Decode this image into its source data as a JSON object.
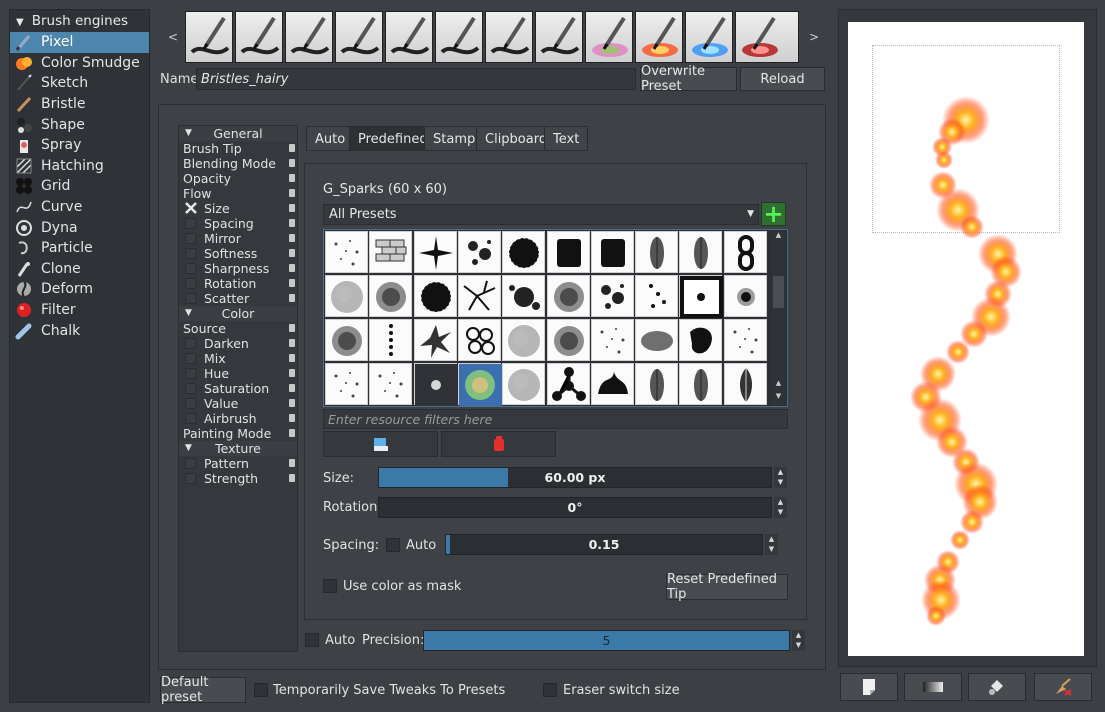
{
  "engines": {
    "header": "Brush engines",
    "items": [
      {
        "label": "Pixel",
        "icon": "pixel-brush-icon",
        "selected": true
      },
      {
        "label": "Color Smudge",
        "icon": "color-smudge-icon"
      },
      {
        "label": "Sketch",
        "icon": "sketch-icon"
      },
      {
        "label": "Bristle",
        "icon": "bristle-icon"
      },
      {
        "label": "Shape",
        "icon": "shape-icon"
      },
      {
        "label": "Spray",
        "icon": "spray-icon"
      },
      {
        "label": "Hatching",
        "icon": "hatching-icon"
      },
      {
        "label": "Grid",
        "icon": "grid-icon"
      },
      {
        "label": "Curve",
        "icon": "curve-icon"
      },
      {
        "label": "Dyna",
        "icon": "dyna-icon"
      },
      {
        "label": "Particle",
        "icon": "particle-icon"
      },
      {
        "label": "Clone",
        "icon": "clone-icon"
      },
      {
        "label": "Deform",
        "icon": "deform-icon"
      },
      {
        "label": "Filter",
        "icon": "filter-icon"
      },
      {
        "label": "Chalk",
        "icon": "chalk-icon"
      }
    ]
  },
  "preset_strip": {
    "prev": "<",
    "next": ">",
    "count": 12
  },
  "name_row": {
    "label": "Name:",
    "value": "Bristles_hairy",
    "overwrite": "Overwrite Preset",
    "reload": "Reload"
  },
  "options": [
    {
      "label": "General",
      "type": "section"
    },
    {
      "label": "Brush Tip",
      "type": "item",
      "lock": true
    },
    {
      "label": "Blending Mode",
      "type": "item",
      "lock": true
    },
    {
      "label": "Opacity",
      "type": "item",
      "lock": true
    },
    {
      "label": "Flow",
      "type": "item",
      "lock": true
    },
    {
      "label": "Size",
      "type": "check",
      "checked": true,
      "lock": true
    },
    {
      "label": "Spacing",
      "type": "check",
      "lock": true
    },
    {
      "label": "Mirror",
      "type": "check",
      "lock": true
    },
    {
      "label": "Softness",
      "type": "check",
      "lock": true
    },
    {
      "label": "Sharpness",
      "type": "check",
      "lock": true
    },
    {
      "label": "Rotation",
      "type": "check",
      "lock": true
    },
    {
      "label": "Scatter",
      "type": "check",
      "lock": true
    },
    {
      "label": "Color",
      "type": "section"
    },
    {
      "label": "Source",
      "type": "item",
      "lock": true
    },
    {
      "label": "Darken",
      "type": "check",
      "lock": true
    },
    {
      "label": "Mix",
      "type": "check",
      "lock": true
    },
    {
      "label": "Hue",
      "type": "check",
      "lock": true
    },
    {
      "label": "Saturation",
      "type": "check",
      "lock": true
    },
    {
      "label": "Value",
      "type": "check",
      "lock": true
    },
    {
      "label": "Airbrush",
      "type": "check",
      "lock": true
    },
    {
      "label": "Painting Mode",
      "type": "item",
      "lock": true
    },
    {
      "label": "Texture",
      "type": "section"
    },
    {
      "label": "Pattern",
      "type": "check",
      "lock": true
    },
    {
      "label": "Strength",
      "type": "check",
      "lock": true
    }
  ],
  "tabs": [
    {
      "label": "Auto"
    },
    {
      "label": "Predefined",
      "active": true
    },
    {
      "label": "Stamp"
    },
    {
      "label": "Clipboard"
    },
    {
      "label": "Text"
    }
  ],
  "tip": {
    "name": "G_Sparks (60 x 60)",
    "preset_filter": "All Presets",
    "resource_filter_placeholder": "Enter resource filters here"
  },
  "size": {
    "label": "Size:",
    "value": "60.00 px",
    "fraction": 0.33
  },
  "rotation": {
    "label": "Rotation:",
    "value": "0°",
    "fraction": 0.0
  },
  "spacing": {
    "label": "Spacing:",
    "auto": "Auto",
    "value": "0.15",
    "fraction": 0.01
  },
  "mask": {
    "label": "Use color as mask"
  },
  "reset": {
    "label": "Reset Predefined Tip"
  },
  "precision": {
    "auto": "Auto",
    "label": "Precision:",
    "value": "5",
    "fraction": 1.0
  },
  "footer": {
    "default_preset": "Default preset",
    "temp_save": "Temporarily Save Tweaks To Presets",
    "eraser_switch": "Eraser switch size"
  },
  "colors": {
    "accent": "#4d86ad",
    "slider": "#3a79a8",
    "add": "#58f058"
  }
}
